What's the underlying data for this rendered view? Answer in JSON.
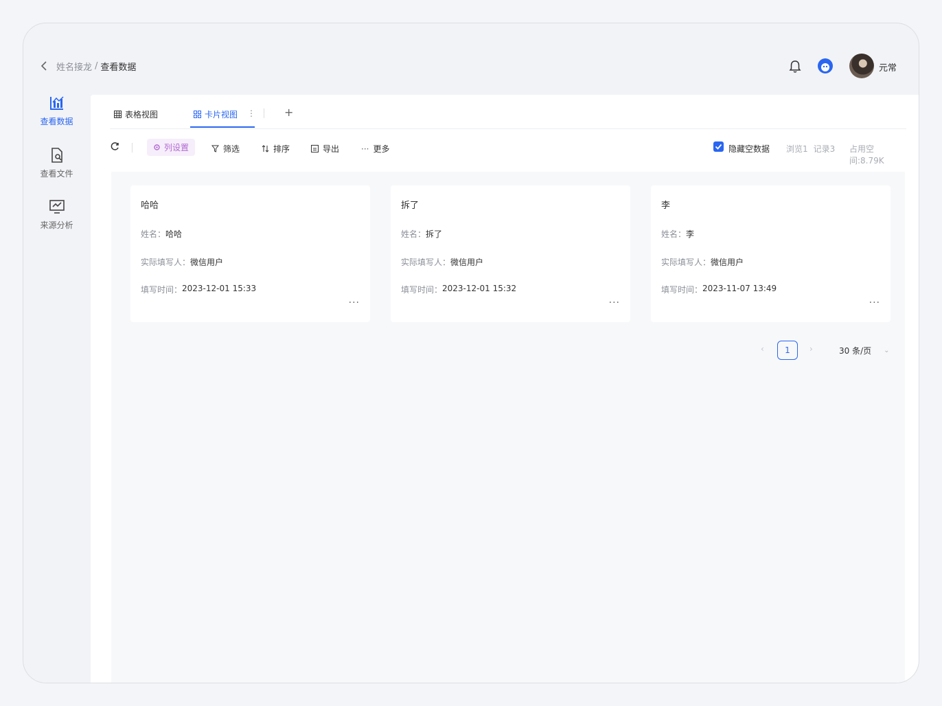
{
  "header": {
    "breadcrumb_parent": "姓名接龙",
    "breadcrumb_sep": "/",
    "breadcrumb_current": "查看数据",
    "username": "元常"
  },
  "sidebar": {
    "items": [
      {
        "label": "查看数据",
        "icon": "chart-icon",
        "active": true
      },
      {
        "label": "查看文件",
        "icon": "file-search-icon",
        "active": false
      },
      {
        "label": "来源分析",
        "icon": "monitor-chart-icon",
        "active": false
      }
    ]
  },
  "tabs": {
    "table_view": "表格视图",
    "card_view": "卡片视图",
    "menu": "⋮",
    "add": "+"
  },
  "toolbar": {
    "column_settings": "列设置",
    "filter": "筛选",
    "sort": "排序",
    "export": "导出",
    "more": "更多",
    "hide_empty": "隐藏空数据",
    "views": "浏览1",
    "records": "记录3",
    "space_used": "占用空间:8.79K"
  },
  "cards": [
    {
      "title": "哈哈",
      "name_label": "姓名：",
      "name": "哈哈",
      "filler_label": "实际填写人：",
      "filler": "微信用户",
      "time_label": "填写时间：",
      "time": "2023-12-01 15:33",
      "more": "···"
    },
    {
      "title": "拆了",
      "name_label": "姓名：",
      "name": "拆了",
      "filler_label": "实际填写人：",
      "filler": "微信用户",
      "time_label": "填写时间：",
      "time": "2023-12-01 15:32",
      "more": "···"
    },
    {
      "title": "李",
      "name_label": "姓名：",
      "name": "李",
      "filler_label": "实际填写人：",
      "filler": "微信用户",
      "time_label": "填写时间：",
      "time": "2023-11-07 13:49",
      "more": "···"
    }
  ],
  "pagination": {
    "prev": "‹",
    "current": "1",
    "next": "›",
    "page_size": "30 条/页",
    "dropdown": "⌄"
  },
  "colors": {
    "accent": "#2a66f0",
    "column_settings": "#b36ad2"
  }
}
